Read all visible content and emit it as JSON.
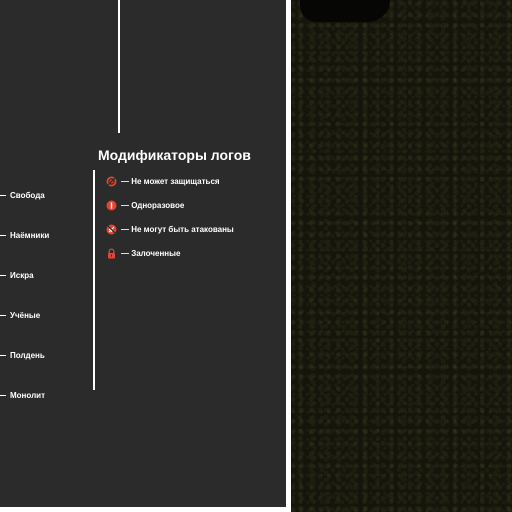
{
  "timeline": {
    "items": [
      {
        "label": "Свобода"
      },
      {
        "label": "Наёмники"
      },
      {
        "label": "Искра"
      },
      {
        "label": "Учёные"
      },
      {
        "label": "Полдень"
      },
      {
        "label": "Монолит"
      }
    ]
  },
  "legend": {
    "title": "Модификаторы логов",
    "items": [
      {
        "icon": "cannot-defend-icon",
        "text": "— Не может защищаться"
      },
      {
        "icon": "one-time-icon",
        "text": "— Одноразовое"
      },
      {
        "icon": "cannot-be-attacked-icon",
        "text": "— Не могут быть атакованы"
      },
      {
        "icon": "lock-icon",
        "text": "— Залоченные"
      }
    ]
  },
  "colors": {
    "panel": "#2b2b2b",
    "accent": "#e5452f",
    "map_bg": "#15150c"
  }
}
